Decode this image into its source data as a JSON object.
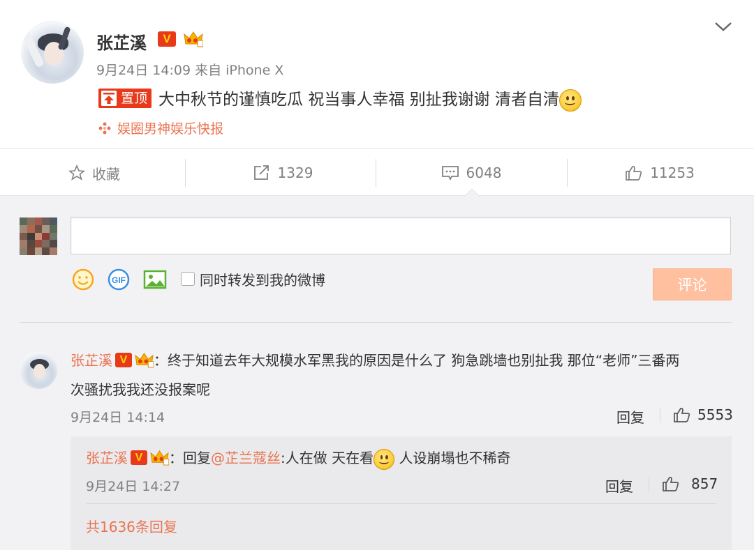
{
  "post": {
    "author": "张芷溪",
    "verified_badge": "V",
    "meta": "9月24日 14:09 来自 iPhone X",
    "pin_label": "置顶",
    "text": "大中秋节的谨慎吃瓜 祝当事人幸福 别扯我谢谢 清者自清",
    "source": "娱圈男神娱乐快报"
  },
  "actions": {
    "favorite": "收藏",
    "repost": "1329",
    "comment": "6048",
    "like": "11253"
  },
  "composer": {
    "placeholder": "",
    "repost_checkbox_label": "同时转发到我的微博",
    "submit_label": "评论",
    "icons": [
      "emoji-icon",
      "gif-icon",
      "image-icon"
    ]
  },
  "comment": {
    "author": "张芷溪",
    "verified_badge": "V",
    "separator": "：",
    "text_line1": "终于知道去年大规模水军黑我的原因是什么了 狗急跳墙也别扯我 那位“老师”三番两",
    "text_line2": "次骚扰我我还没报案呢",
    "time": "9月24日 14:14",
    "reply_label": "回复",
    "likes": "5553"
  },
  "sub_reply": {
    "author": "张芷溪",
    "verified_badge": "V",
    "separator": "：",
    "reply_prefix": "回复",
    "mention": "@芷兰蔻丝",
    "text_before_emoji": ":人在做 天在看",
    "text_after_emoji": " 人设崩塌也不稀奇",
    "time": "9月24日 14:27",
    "reply_label": "回复",
    "likes": "857"
  },
  "more_replies": "共1636条回复",
  "colors": {
    "accent": "#eb7350",
    "badge_red": "#e8391a",
    "background": "#f2f2f5",
    "submit_disabled": "#ffc09f"
  }
}
